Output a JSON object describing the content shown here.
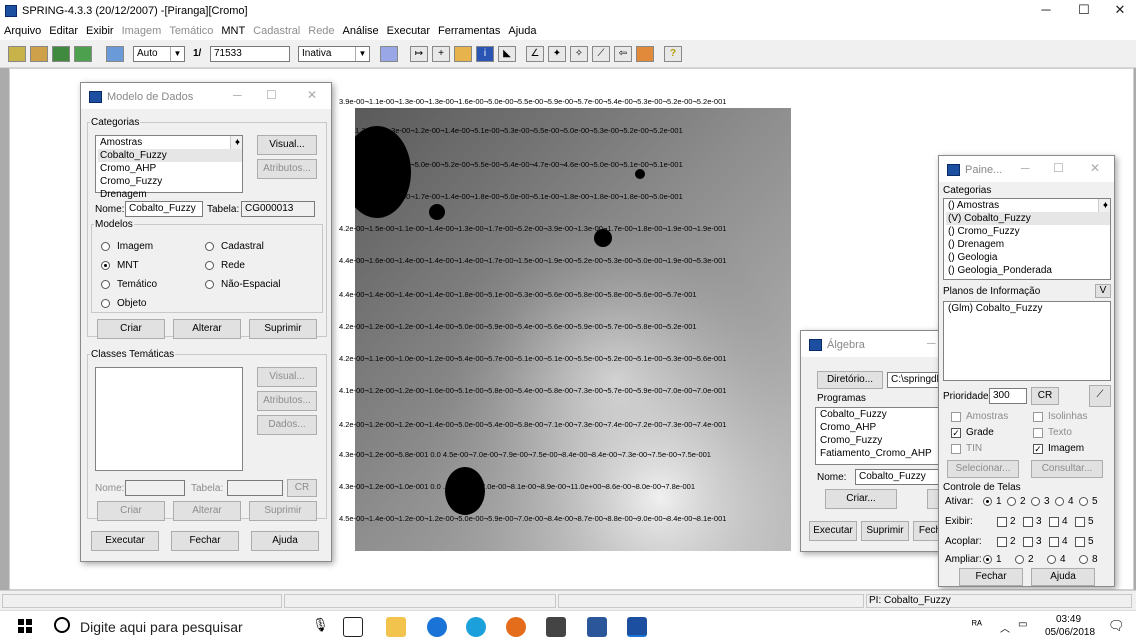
{
  "app": {
    "title": "SPRING-4.3.3 (20/12/2007) -[Piranga][Cromo]",
    "window_controls": {
      "minimize": "─",
      "maximize": "☐",
      "close": "✕"
    }
  },
  "menubar": [
    {
      "label": "Arquivo",
      "enabled": true
    },
    {
      "label": "Editar",
      "enabled": true
    },
    {
      "label": "Exibir",
      "enabled": true
    },
    {
      "label": "Imagem",
      "enabled": false
    },
    {
      "label": "Temático",
      "enabled": false
    },
    {
      "label": "MNT",
      "enabled": true
    },
    {
      "label": "Cadastral",
      "enabled": false
    },
    {
      "label": "Rede",
      "enabled": false
    },
    {
      "label": "Análise",
      "enabled": true
    },
    {
      "label": "Executar",
      "enabled": true
    },
    {
      "label": "Ferramentas",
      "enabled": true
    },
    {
      "label": "Ajuda",
      "enabled": true
    }
  ],
  "toolbar": {
    "mode_combo": "Auto",
    "scale_prefix": "1/",
    "scale_value": "71533",
    "state_combo": "Inativa",
    "help_symbol": "?"
  },
  "modelo_dados": {
    "title": "Modelo de Dados",
    "categorias_label": "Categorias",
    "categorias": [
      "Amostras",
      "Cobalto_Fuzzy",
      "Cromo_AHP",
      "Cromo_Fuzzy",
      "Drenagem"
    ],
    "selected_categoria": 1,
    "visual_button": "Visual...",
    "atributos_button": "Atributos...",
    "nome_label": "Nome:",
    "nome_value": "Cobalto_Fuzzy",
    "tabela_label": "Tabela:",
    "tabela_value": "CG000013",
    "modelos_label": "Modelos",
    "modelos": [
      {
        "label": "Imagem",
        "checked": false
      },
      {
        "label": "Cadastral",
        "checked": false
      },
      {
        "label": "MNT",
        "checked": true
      },
      {
        "label": "Rede",
        "checked": false
      },
      {
        "label": "Temático",
        "checked": false
      },
      {
        "label": "Não-Espacial",
        "checked": false
      },
      {
        "label": "Objeto",
        "checked": false
      }
    ],
    "criar_button": "Criar",
    "alterar_button": "Alterar",
    "suprimir_button": "Suprimir",
    "classes_label": "Classes Temáticas",
    "classes_visual_button": "Visual...",
    "classes_atributos_button": "Atributos...",
    "classes_dados_button": "Dados...",
    "classes_nome_label": "Nome:",
    "classes_tabela_label": "Tabela:",
    "cr_button": "CR",
    "classes_criar_button": "Criar",
    "classes_alterar_button": "Alterar",
    "classes_suprimir_button": "Suprimir",
    "executar_button": "Executar",
    "fechar_button": "Fechar",
    "ajuda_button": "Ajuda"
  },
  "canvas": {
    "top_label": "3.9e-00¬1.1e-00¬1.3e-00¬1.3e-00¬1.6e-00¬5.0e-00¬5.5e-00¬5.9e-00¬5.7e-00¬5.4e-00¬5.3e-00¬5.2e-00¬5.2e-001",
    "rows": [
      "1.3e-00¬1.3e-00¬1.2e-00¬1.4e-00¬5.1e-00¬5.3e-00¬5.5e-00¬5.0e-00¬5.3e-00¬5.2e-00¬5.2e-001",
      "1.1e-00¬0.9e-00¬5.0e-00¬5.2e-00¬5.5e-00¬5.4e-00¬4.7e-00¬4.6e-00¬5.0e-00¬5.1e-00¬5.1e-001",
      "1.3e-00¬0.9e-00¬1.7e-00¬1.4e-00¬1.8e-00¬5.0e-00¬5.1e-00¬1.8e-00¬1.8e-00¬1.8e-00¬5.0e-001",
      "4.2e-00¬1.5e-00¬1.1e-00¬1.4e-00¬1.3e-00¬1.7e-00¬5.2e-00¬3.9e-00¬1.3e-00¬1.7e-00¬1.8e-00¬1.9e-00¬1.9e-001",
      "4.4e-00¬1.6e-00¬1.4e-00¬1.4e-00¬1.4e-00¬1.7e-00¬1.5e-00¬1.9e-00¬5.2e-00¬5.3e-00¬5.0e-00¬1.9e-00¬5.3e-001",
      "4.4e-00¬1.4e-00¬1.4e-00¬1.4e-00¬1.8e-00¬5.1e-00¬5.3e-00¬5.6e-00¬5.8e-00¬5.8e-00¬5.6e-00¬5.7e-001",
      "4.2e-00¬1.2e-00¬1.2e-00¬1.4e-00¬5.0e-00¬5.9e-00¬5.4e-00¬5.6e-00¬5.9e-00¬5.7e-00¬5.8e-00¬5.2e-001",
      "4.2e-00¬1.1e-00¬1.0e-00¬1.2e-00¬5.4e-00¬5.7e-00¬5.1e-00¬5.1e-00¬5.5e-00¬5.2e-00¬5.1e-00¬5.3e-00¬5.6e-001",
      "4.1e-00¬1.2e-00¬1.2e-00¬1.6e-00¬5.1e-00¬5.8e-00¬5.4e-00¬5.8e-00¬7.3e-00¬5.7e-00¬5.9e-00¬7.0e-00¬7.0e-001",
      "4.2e-00¬1.2e-00¬1.2e-00¬1.4e-00¬5.0e-00¬5.4e-00¬5.8e-00¬7.1e-00¬7.3e-00¬7.4e-00¬7.2e-00¬7.3e-00¬7.4e-001",
      "4.3e-00¬1.2e-00¬5.8e-001 0.0 4.5e-00¬7.0e-00¬7.9e-00¬7.5e-00¬8.4e-00¬8.4e-00¬7.3e-00¬7.5e-00¬7.5e-001",
      "4.3e-00¬1.2e-00¬1.0e-001 0.0 ... 5.3e-00¬7.0e-00¬8.1e-00¬8.9e-00¬11.0e+00¬8.6e-00¬8.0e-00¬7.8e-001",
      "4.5e-00¬1.4e-00¬1.2e-00¬1.2e-00¬5.0e-00¬5.9e-00¬7.0e-00¬8.4e-00¬8.7e-00¬8.8e-00¬9.0e-00¬8.4e-00¬8.1e-001"
    ]
  },
  "algebra": {
    "title": "Álgebra",
    "diretorio_button": "Diretório...",
    "diretorio_value": "C:\\springdb\\",
    "programas_label": "Programas",
    "programas": [
      "Cobalto_Fuzzy",
      "Cromo_AHP",
      "Cromo_Fuzzy",
      "Fatiamento_Cromo_AHP"
    ],
    "nome_label": "Nome:",
    "nome_value": "Cobalto_Fuzzy",
    "criar_button": "Criar...",
    "executar_button": "Executar",
    "suprimir_button": "Suprimir",
    "fechar_button": "Fech"
  },
  "painel": {
    "title": "Paine...",
    "categorias_label": "Categorias",
    "categorias": [
      "() Amostras",
      "(V) Cobalto_Fuzzy",
      "() Cromo_Fuzzy",
      "() Drenagem",
      "() Geologia",
      "() Geologia_Ponderada"
    ],
    "selected_categoria": 1,
    "planos_label": "Planos de Informação",
    "planos_toggle": "V",
    "planos": [
      "(Glm) Cobalto_Fuzzy"
    ],
    "prioridade_label": "Prioridade:",
    "prioridade_value": "300",
    "cr_button": "CR",
    "checks": [
      {
        "label": "Amostras",
        "checked": false,
        "enabled": false
      },
      {
        "label": "Isolinhas",
        "checked": false,
        "enabled": false
      },
      {
        "label": "Grade",
        "checked": true,
        "enabled": true
      },
      {
        "label": "Texto",
        "checked": false,
        "enabled": false
      },
      {
        "label": "TIN",
        "checked": false,
        "enabled": false
      },
      {
        "label": "Imagem",
        "checked": true,
        "enabled": true
      }
    ],
    "selecionar_button": "Selecionar...",
    "consultar_button": "Consultar...",
    "controle_label": "Controle de Telas",
    "ativar_label": "Ativar:",
    "exibir_label": "Exibir:",
    "acoplar_label": "Acoplar:",
    "ampliar_label": "Ampliar:",
    "screen_numbers": [
      "1",
      "2",
      "3",
      "4",
      "5"
    ],
    "ampliar_numbers": [
      "1",
      "2",
      "4",
      "8"
    ],
    "fechar_button": "Fechar",
    "ajuda_button": "Ajuda"
  },
  "statusbar": {
    "pi_label": "PI: Cobalto_Fuzzy"
  },
  "taskbar": {
    "search_placeholder": "Digite aqui para pesquisar",
    "time": "03:49",
    "date": "05/06/2018",
    "tray_text": "ᴿᴬ"
  }
}
